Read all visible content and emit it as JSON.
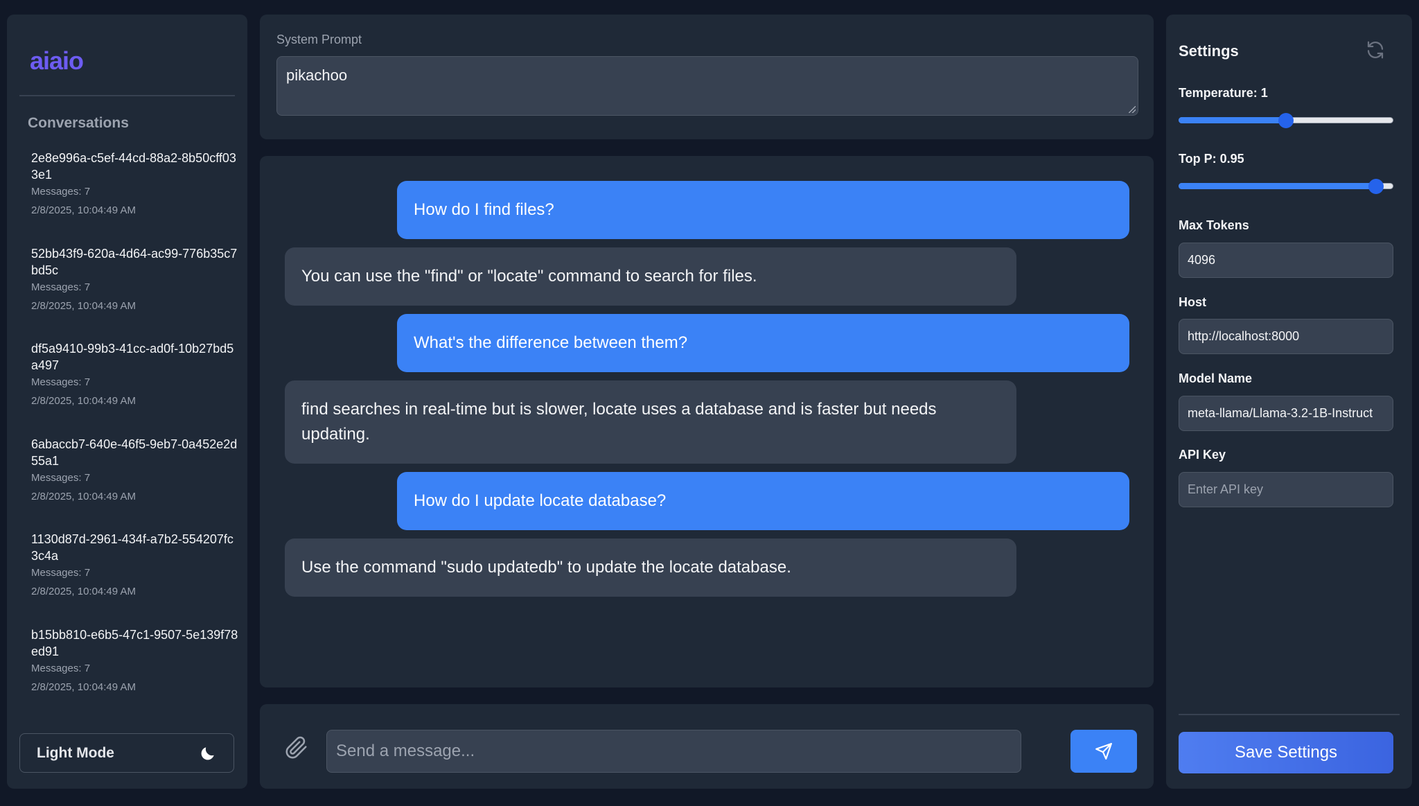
{
  "app": {
    "logo": "aiaio"
  },
  "sidebar": {
    "heading": "Conversations",
    "conversations": [
      {
        "id": "2e8e996a-c5ef-44cd-88a2-8b50cff033e1",
        "messages": "Messages: 7",
        "date": "2/8/2025, 10:04:49 AM"
      },
      {
        "id": "52bb43f9-620a-4d64-ac99-776b35c7bd5c",
        "messages": "Messages: 7",
        "date": "2/8/2025, 10:04:49 AM"
      },
      {
        "id": "df5a9410-99b3-41cc-ad0f-10b27bd5a497",
        "messages": "Messages: 7",
        "date": "2/8/2025, 10:04:49 AM"
      },
      {
        "id": "6abaccb7-640e-46f5-9eb7-0a452e2d55a1",
        "messages": "Messages: 7",
        "date": "2/8/2025, 10:04:49 AM"
      },
      {
        "id": "1130d87d-2961-434f-a7b2-554207fc3c4a",
        "messages": "Messages: 7",
        "date": "2/8/2025, 10:04:49 AM"
      },
      {
        "id": "b15bb810-e6b5-47c1-9507-5e139f78ed91",
        "messages": "Messages: 7",
        "date": "2/8/2025, 10:04:49 AM"
      }
    ],
    "mode_button": {
      "label": "Light Mode",
      "icon": "moon-icon"
    }
  },
  "system_prompt": {
    "label": "System Prompt",
    "value": "pikachoo"
  },
  "chat": {
    "messages": [
      {
        "role": "user",
        "text": "How do I find files?"
      },
      {
        "role": "assistant",
        "text": "You can use the \"find\" or \"locate\" command to search for files."
      },
      {
        "role": "user",
        "text": "What's the difference between them?"
      },
      {
        "role": "assistant",
        "text": "find searches in real-time but is slower, locate uses a database and is faster but needs updating."
      },
      {
        "role": "user",
        "text": "How do I update locate database?"
      },
      {
        "role": "assistant",
        "text": "Use the command \"sudo updatedb\" to update the locate database."
      }
    ]
  },
  "composer": {
    "placeholder": "Send a message...",
    "attach_icon": "paperclip-icon",
    "send_icon": "send-icon"
  },
  "settings": {
    "title": "Settings",
    "reset_icon": "refresh-icon",
    "temperature": {
      "label": "Temperature: 1",
      "value": 1,
      "min": 0,
      "max": 2
    },
    "top_p": {
      "label": "Top P: 0.95",
      "value": 0.95,
      "min": 0,
      "max": 1
    },
    "max_tokens": {
      "label": "Max Tokens",
      "value": "4096"
    },
    "host": {
      "label": "Host",
      "value": "http://localhost:8000"
    },
    "model_name": {
      "label": "Model Name",
      "value": "meta-llama/Llama-3.2-1B-Instruct"
    },
    "api_key": {
      "label": "API Key",
      "placeholder": "Enter API key",
      "value": ""
    },
    "save_label": "Save Settings"
  },
  "colors": {
    "background": "#111827",
    "panel": "#1f2937",
    "accent": "#3b82f6",
    "logo": "#6d5cf2"
  }
}
